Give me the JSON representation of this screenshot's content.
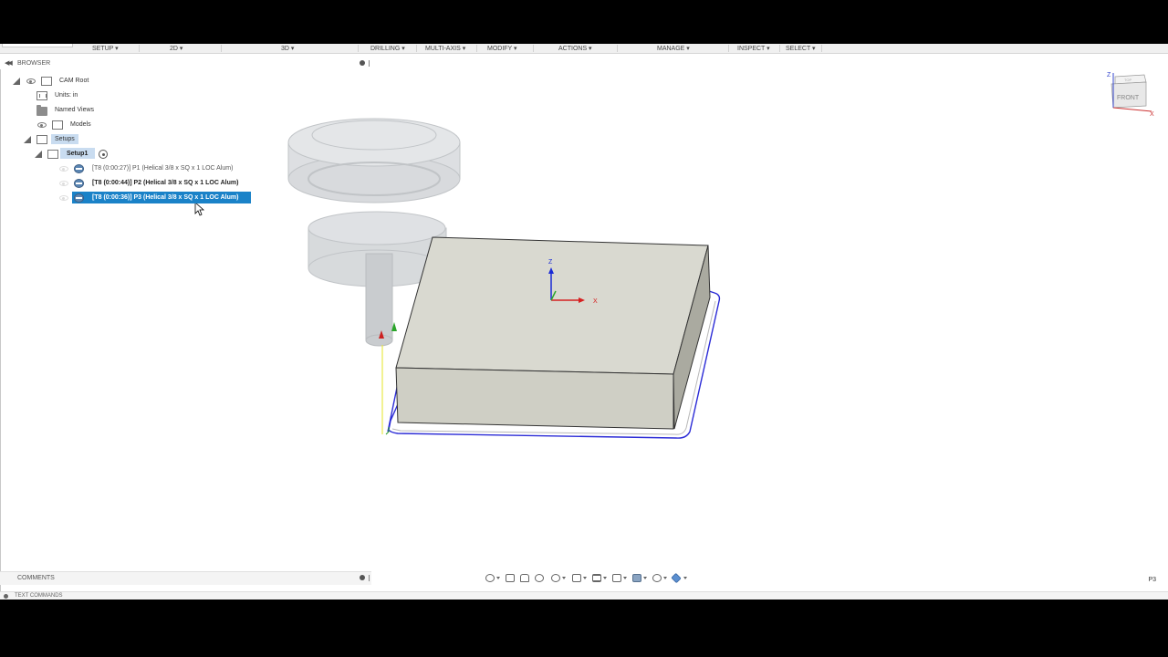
{
  "toolbar": {
    "items": [
      {
        "label": "SETUP ▾"
      },
      {
        "label": "2D ▾"
      },
      {
        "label": "3D ▾"
      },
      {
        "label": "DRILLING ▾"
      },
      {
        "label": "MULTI-AXIS ▾"
      },
      {
        "label": "MODIFY ▾"
      },
      {
        "label": "ACTIONS ▾"
      },
      {
        "label": "MANAGE ▾"
      },
      {
        "label": "INSPECT ▾"
      },
      {
        "label": "SELECT ▾"
      }
    ]
  },
  "browser": {
    "title": "BROWSER",
    "root": "CAM Root",
    "units": "Units: in",
    "named_views": "Named Views",
    "models": "Models",
    "setups": "Setups",
    "setup1": "Setup1",
    "operations": [
      {
        "label": "[T8 (0:00:27)] P1 (Helical 3/8 x SQ x 1 LOC Alum)"
      },
      {
        "label": "[T8 (0:00:44)] P2 (Helical 3/8 x SQ x 1 LOC Alum)"
      },
      {
        "label": "[T8 (0:00:36)] P3 (Helical 3/8 x SQ x 1 LOC Alum)"
      }
    ]
  },
  "viewport": {
    "triad": {
      "z": "Z",
      "x": "X"
    },
    "viewcube": {
      "face": "FRONT",
      "top": "TOP",
      "z": "Z",
      "x": "X"
    }
  },
  "comments": {
    "title": "COMMENTS"
  },
  "text_commands": {
    "title": "TEXT COMMANDS"
  },
  "status": {
    "active_op": "P3"
  },
  "colors": {
    "selection": "#1a82c8",
    "toolpath": "#2b2bd6",
    "stock": "#d9d9d0"
  }
}
